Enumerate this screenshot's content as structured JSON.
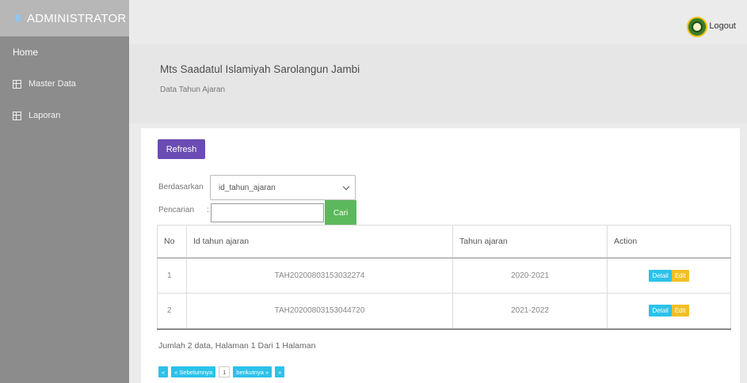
{
  "sidebar": {
    "brand": "ADMINISTRATOR",
    "items": [
      {
        "label": "Home"
      },
      {
        "label": "Master Data"
      },
      {
        "label": "Laporan"
      }
    ]
  },
  "topbar": {
    "logout_label": "Logout"
  },
  "header": {
    "school_name": "Mts Saadatul Islamiyah Sarolangun Jambi",
    "subtitle": "Data Tahun Ajaran"
  },
  "controls": {
    "refresh_label": "Refresh",
    "filter_label": "Berdasarkan",
    "filter_selected": "id_tahun_ajaran",
    "search_label": "Pencarian",
    "search_value": "",
    "search_button": "Cari"
  },
  "table": {
    "columns": [
      "No",
      "Id tahun ajaran",
      "Tahun ajaran",
      "Action"
    ],
    "rows": [
      {
        "no": "1",
        "id": "TAH20200803153032274",
        "year": "2020-2021",
        "detail": "Detail",
        "edit": "Edit"
      },
      {
        "no": "2",
        "id": "TAH20200803153044720",
        "year": "2021-2022",
        "detail": "Detail",
        "edit": "Edit"
      }
    ]
  },
  "summary": "Jumlah 2 data, Halaman 1 Dari 1 Halaman",
  "pagination": {
    "first": "«",
    "prev": "« Sebelumnya",
    "current": "1",
    "next": "berikutnya »",
    "last": "»"
  },
  "colors": {
    "sidebar": "#8c8c8c",
    "refresh": "#6a4cb3",
    "cari": "#5cb85c",
    "detail": "#2bc2ea",
    "edit": "#f2bf26"
  }
}
